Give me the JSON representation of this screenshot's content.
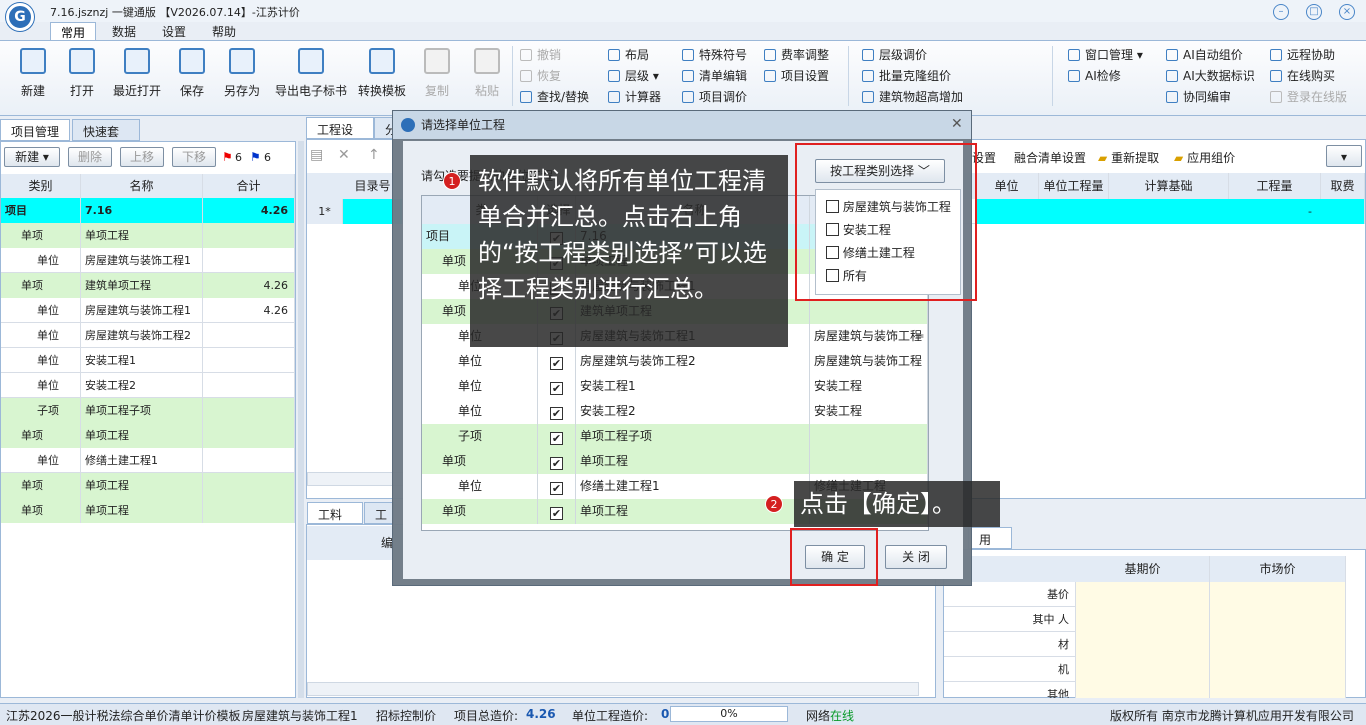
{
  "app": {
    "title": "7.16.jsznzj 一键通版 【V2026.07.14】-江苏计价"
  },
  "menu": [
    "常用",
    "数据",
    "设置",
    "帮助"
  ],
  "ribbon": {
    "big": [
      "新建",
      "打开",
      "最近打开",
      "保存",
      "另存为",
      "导出电子标书",
      "转换模板",
      "复制",
      "粘贴"
    ],
    "col1": [
      "撤销",
      "恢复",
      "查找/替换"
    ],
    "col2": [
      "布局",
      "层级",
      "计算器"
    ],
    "col3": [
      "特殊符号",
      "清单编辑",
      "项目调价"
    ],
    "col4": [
      "费率调整",
      "项目设置"
    ],
    "col5": [
      "层级调价",
      "批量克隆组价",
      "建筑物超高增加"
    ],
    "col6": [
      "窗口管理",
      "AI检修"
    ],
    "col7": [
      "AI自动组价",
      "AI大数据标识",
      "协同编审"
    ],
    "col8": [
      "远程协助",
      "在线购买",
      "登录在线版"
    ]
  },
  "left": {
    "tabs": [
      "项目管理",
      "快速套用"
    ],
    "toolbar": [
      "新建",
      "删除",
      "上移",
      "下移",
      "6",
      "6"
    ],
    "headers": [
      "类别",
      "名称",
      "合计"
    ],
    "rows": [
      {
        "type": "项目",
        "name": "7.16",
        "total": "4.26"
      },
      {
        "type": "单项",
        "name": "单项工程",
        "total": ""
      },
      {
        "type": "单位",
        "name": "房屋建筑与装饰工程1",
        "total": ""
      },
      {
        "type": "单项",
        "name": "建筑单项工程",
        "total": "4.26"
      },
      {
        "type": "单位",
        "name": "房屋建筑与装饰工程1",
        "total": "4.26"
      },
      {
        "type": "单位",
        "name": "房屋建筑与装饰工程2",
        "total": ""
      },
      {
        "type": "单位",
        "name": "安装工程1",
        "total": ""
      },
      {
        "type": "单位",
        "name": "安装工程2",
        "total": ""
      },
      {
        "type": "子项",
        "name": "单项工程子项",
        "total": ""
      },
      {
        "type": "单项",
        "name": "单项工程",
        "total": ""
      },
      {
        "type": "单位",
        "name": "修缮土建工程1",
        "total": ""
      },
      {
        "type": "单项",
        "name": "单项工程",
        "total": ""
      },
      {
        "type": "单项",
        "name": "单项工程",
        "total": ""
      }
    ]
  },
  "main": {
    "tabs": [
      "工程设置",
      "分"
    ],
    "toolbar_right": [
      "设置",
      "融合清单设置",
      "重新提取",
      "应用组价"
    ],
    "headers": [
      "目录号",
      "单位",
      "单位工程量",
      "计算基础",
      "工程量",
      "取费"
    ],
    "row1": {
      "no": "1*",
      "qty": "-"
    },
    "bottom_tabs": [
      "工料机",
      "工程"
    ],
    "bottom_col": "编",
    "right_tab": "用基价",
    "right_headers": [
      "基期价",
      "市场价"
    ],
    "right_rows": [
      "基价",
      "其中 人",
      "材",
      "机",
      "其他"
    ]
  },
  "dialog": {
    "title": "请选择单位工程",
    "hint": "请勾选要提取的单位工程",
    "filter_button": "按工程类别选择",
    "filter_options": [
      "房屋建筑与装饰工程",
      "安装工程",
      "修缮土建工程",
      "所有"
    ],
    "headers": [
      "类",
      "选择",
      "名称",
      ""
    ],
    "rows": [
      {
        "type": "项目",
        "name": "7.16",
        "cat": ""
      },
      {
        "type": "单项",
        "name": "单项工程",
        "cat": ""
      },
      {
        "type": "单位",
        "name": "房屋建筑与装饰工程1",
        "cat": ""
      },
      {
        "type": "单项",
        "name": "建筑单项工程",
        "cat": ""
      },
      {
        "type": "单位",
        "name": "房屋建筑与装饰工程1",
        "cat": "房屋建筑与装饰工程"
      },
      {
        "type": "单位",
        "name": "房屋建筑与装饰工程2",
        "cat": "房屋建筑与装饰工程"
      },
      {
        "type": "单位",
        "name": "安装工程1",
        "cat": "安装工程"
      },
      {
        "type": "单位",
        "name": "安装工程2",
        "cat": "安装工程"
      },
      {
        "type": "子项",
        "name": "单项工程子项",
        "cat": ""
      },
      {
        "type": "单项",
        "name": "单项工程",
        "cat": ""
      },
      {
        "type": "单位",
        "name": "修缮土建工程1",
        "cat": "修缮土建工程"
      },
      {
        "type": "单项",
        "name": "单项工程",
        "cat": ""
      }
    ],
    "ok": "确 定",
    "close": "关 闭"
  },
  "callouts": {
    "c1_num": "1",
    "c1_text": "软件默认将所有单位工程清单合并汇总。点击右上角的“按工程类别选择”可以选择工程类别进行汇总。",
    "c2_num": "2",
    "c2_text": "点击【确定】。"
  },
  "status": {
    "template": "江苏2026一般计税法综合单价清单计价模板",
    "unit": "房屋建筑与装饰工程1",
    "ctrl": "招标控制价",
    "total_label": "项目总造价:",
    "total": "4.26",
    "unit_label": "单位工程造价:",
    "unit_val": "0",
    "progress": "0%",
    "net_label": "网络",
    "net_val": "在线",
    "copyright": "版权所有 南京市龙腾计算机应用开发有限公司"
  }
}
